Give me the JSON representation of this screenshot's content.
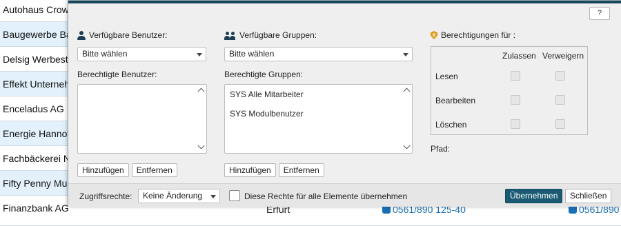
{
  "background": {
    "rows": [
      {
        "name": "Autohaus Crow"
      },
      {
        "name": "Baugewerbe Ba"
      },
      {
        "name": "Delsig Werbest"
      },
      {
        "name": "Effekt Unterneh"
      },
      {
        "name": "Enceladus AG"
      },
      {
        "name": "Energie Hannov"
      },
      {
        "name": "Fachbäckerei N"
      },
      {
        "name": "Fifty Penny Mu"
      },
      {
        "name": "Finanzbank AG"
      }
    ],
    "partial_city": "Erfurt",
    "partial_phone_1": "0561/890 125-40",
    "partial_phone_2": "0561/890"
  },
  "dialog": {
    "help_label": "?",
    "users": {
      "available_label": "Verfügbare Benutzer:",
      "select_value": "Bitte wählen",
      "authorized_label": "Berechtigte Benutzer:",
      "items": [],
      "add_label": "Hinzufügen",
      "remove_label": "Entfernen"
    },
    "groups": {
      "available_label": "Verfügbare Gruppen:",
      "select_value": "Bitte wählen",
      "authorized_label": "Berechtigte Gruppen:",
      "items": [
        "SYS Alle Mitarbeiter",
        "SYS Modulbenutzer"
      ],
      "add_label": "Hinzufügen",
      "remove_label": "Entfernen"
    },
    "permissions": {
      "title": "Berechtigungen für :",
      "allow_header": "Zulassen",
      "deny_header": "Verweigern",
      "rows": [
        {
          "label": "Lesen",
          "allow": false,
          "deny": false
        },
        {
          "label": "Bearbeiten",
          "allow": false,
          "deny": false
        },
        {
          "label": "Löschen",
          "allow": false,
          "deny": false
        }
      ],
      "path_label": "Pfad:"
    },
    "footer": {
      "access_label": "Zugriffsrechte:",
      "access_value": "Keine Änderung",
      "apply_all_label": "Diese Rechte für alle Elemente übernehmen",
      "apply_all_checked": false,
      "apply_button": "Übernehmen",
      "close_button": "Schließen"
    }
  },
  "colors": {
    "dialog_bar": "#18485a",
    "primary_button": "#1a5a73",
    "row_highlight": "#e2f1fb",
    "permission_icon": "#d99a1e",
    "phone": "#1a6fb5"
  }
}
